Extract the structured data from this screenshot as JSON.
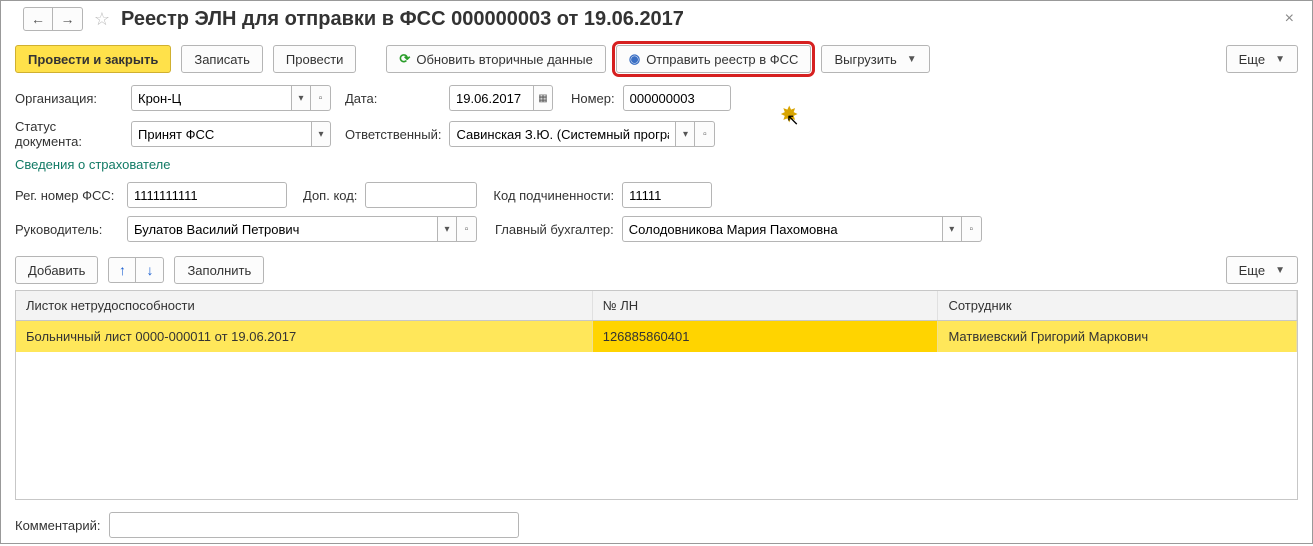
{
  "title": "Реестр ЭЛН для отправки в ФСС 000000003 от 19.06.2017",
  "nav": {
    "back": "←",
    "fwd": "→"
  },
  "toolbar": {
    "post_close": "Провести и закрыть",
    "save": "Записать",
    "post": "Провести",
    "refresh": "Обновить вторичные данные",
    "send": "Отправить реестр в ФСС",
    "export": "Выгрузить",
    "more": "Еще"
  },
  "fields": {
    "org_label": "Организация:",
    "org_value": "Крон-Ц",
    "date_label": "Дата:",
    "date_value": "19.06.2017",
    "num_label": "Номер:",
    "num_value": "000000003",
    "status_label": "Статус документа:",
    "status_value": "Принят ФСС",
    "resp_label": "Ответственный:",
    "resp_value": "Савинская З.Ю. (Системный програм",
    "section": "Сведения о страхователе",
    "reg_label": "Рег. номер ФСС:",
    "reg_value": "1111111111",
    "dop_label": "Доп. код:",
    "dop_value": "",
    "sub_label": "Код подчиненности:",
    "sub_value": "11111",
    "head_label": "Руководитель:",
    "head_value": "Булатов Василий Петрович",
    "acc_label": "Главный бухгалтер:",
    "acc_value": "Солодовникова Мария Пахомовна",
    "comment_label": "Комментарий:",
    "comment_value": ""
  },
  "table_toolbar": {
    "add": "Добавить",
    "fill": "Заполнить",
    "more": "Еще"
  },
  "table": {
    "cols": [
      "Листок нетрудоспособности",
      "№ ЛН",
      "Сотрудник"
    ],
    "rows": [
      {
        "doc": "Больничный лист 0000-000011 от 19.06.2017",
        "num": "126885860401",
        "emp": "Матвиевский Григорий Маркович"
      }
    ]
  }
}
